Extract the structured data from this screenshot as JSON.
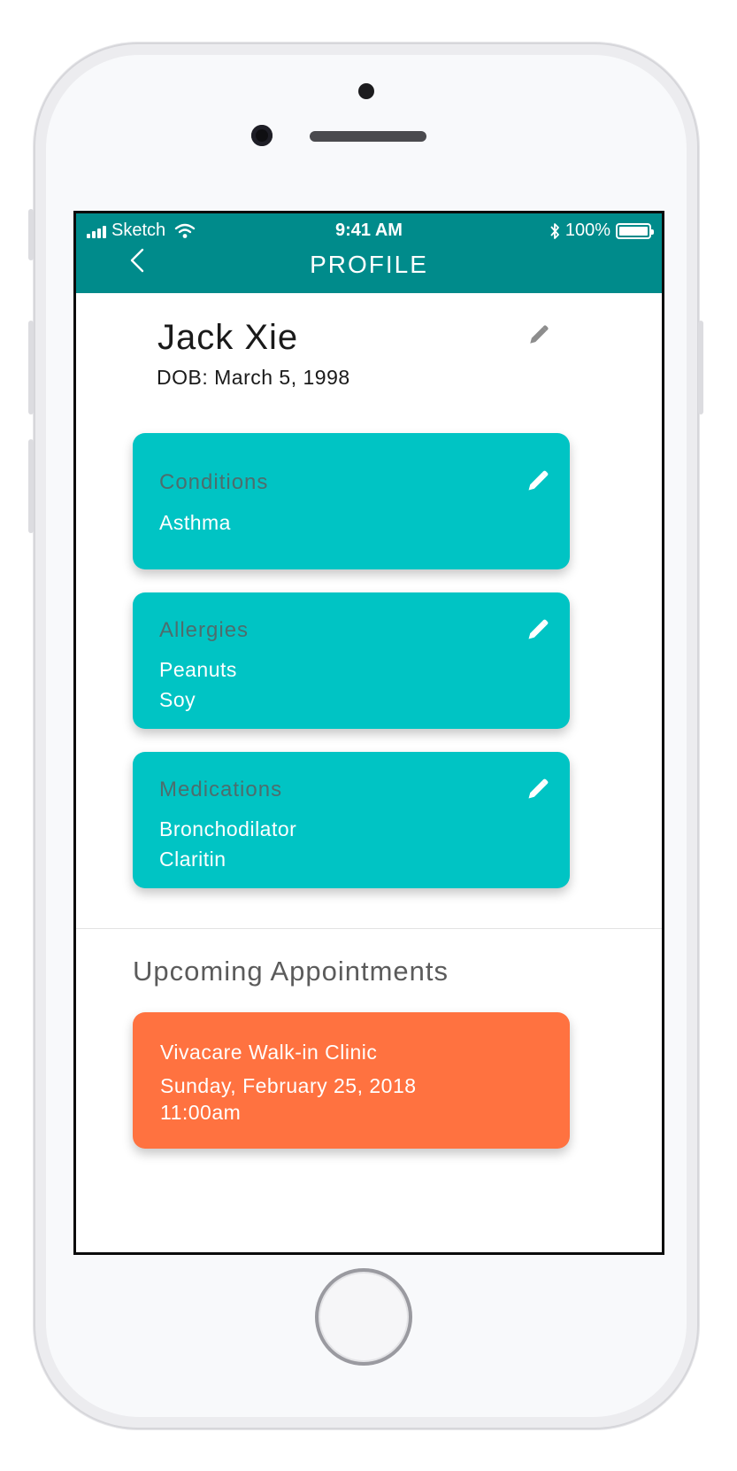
{
  "status_bar": {
    "carrier": "Sketch",
    "time": "9:41 AM",
    "battery": "100%",
    "battery_level": 1.0
  },
  "header": {
    "title": "PROFILE",
    "back_icon": "chevron-left-icon"
  },
  "profile": {
    "name": "Jack Xie",
    "dob": "DOB: March 5, 1998",
    "edit_icon": "pencil-icon"
  },
  "cards": [
    {
      "label": "Conditions",
      "values": [
        "Asthma"
      ]
    },
    {
      "label": "Allergies",
      "values": [
        "Peanuts",
        "Soy"
      ]
    },
    {
      "label": "Medications",
      "values": [
        "Bronchodilator",
        "Claritin"
      ]
    }
  ],
  "appointments": {
    "title": "Upcoming Appointments",
    "items": [
      {
        "clinic": "Vivacare Walk-in Clinic",
        "date": "Sunday, February 25, 2018",
        "time": "11:00am"
      }
    ]
  },
  "colors": {
    "header": "#008b8b",
    "card": "#00c4c4",
    "card_label": "#4d6d6d",
    "appointment": "#ff7240"
  }
}
